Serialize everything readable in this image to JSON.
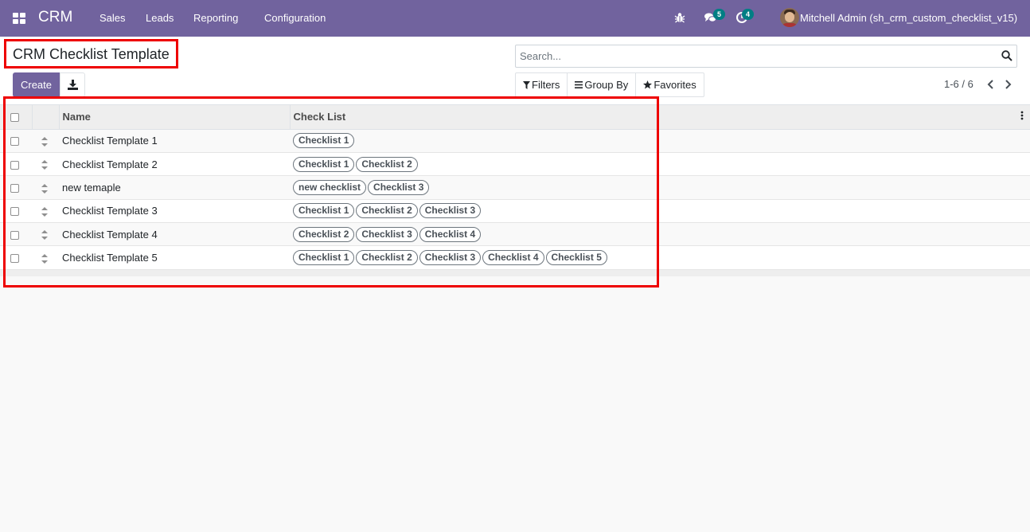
{
  "navbar": {
    "app_name": "CRM",
    "menu": [
      "Sales",
      "Leads",
      "Reporting",
      "Configuration"
    ],
    "messages_count": "5",
    "activities_count": "4",
    "user_name": "Mitchell Admin (sh_crm_custom_checklist_v15)"
  },
  "control_panel": {
    "title": "CRM Checklist Template",
    "create_label": "Create",
    "search_placeholder": "Search...",
    "filters_label": "Filters",
    "group_by_label": "Group By",
    "favorites_label": "Favorites",
    "pager_value": "1-6 / 6"
  },
  "list": {
    "columns": [
      "Name",
      "Check List"
    ],
    "rows": [
      {
        "name": "Checklist Template 1",
        "checklists": [
          "Checklist 1"
        ]
      },
      {
        "name": "Checklist Template 2",
        "checklists": [
          "Checklist 1",
          "Checklist 2"
        ]
      },
      {
        "name": "new temaple",
        "checklists": [
          "new checklist",
          "Checklist 3"
        ]
      },
      {
        "name": "Checklist Template 3",
        "checklists": [
          "Checklist 1",
          "Checklist 2",
          "Checklist 3"
        ]
      },
      {
        "name": "Checklist Template 4",
        "checklists": [
          "Checklist 2",
          "Checklist 3",
          "Checklist 4"
        ]
      },
      {
        "name": "Checklist Template 5",
        "checklists": [
          "Checklist 1",
          "Checklist 2",
          "Checklist 3",
          "Checklist 4",
          "Checklist 5"
        ]
      }
    ]
  },
  "colors": {
    "brand": "#71639e",
    "badge": "#017e84",
    "highlight": "#ee0000"
  }
}
